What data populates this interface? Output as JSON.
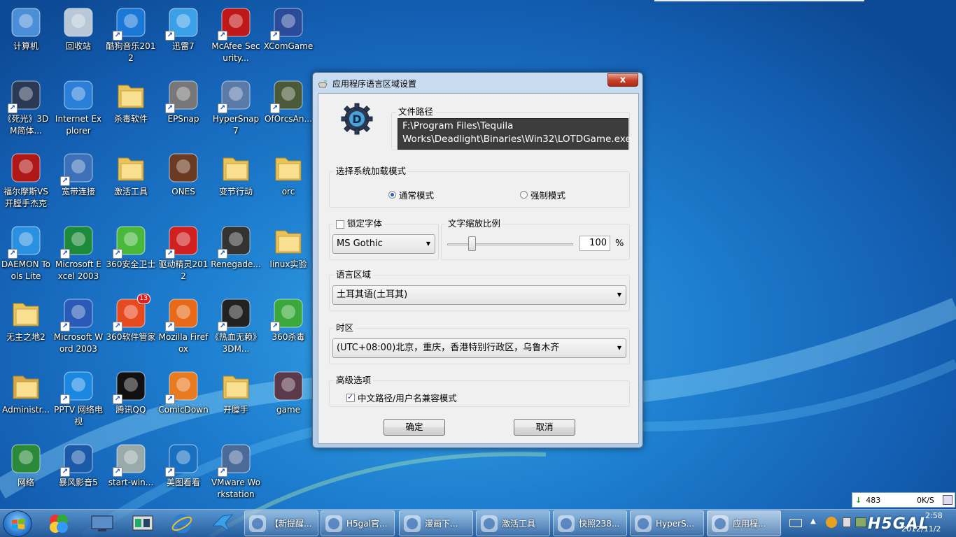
{
  "desktop": {
    "icons": [
      {
        "label": "计算机",
        "icon": "computer-icon",
        "shortcut": false
      },
      {
        "label": "回收站",
        "icon": "recycle-bin-icon",
        "shortcut": false
      },
      {
        "label": "酷狗音乐2012",
        "icon": "kugou-music-icon",
        "shortcut": true
      },
      {
        "label": "迅雷7",
        "icon": "xunlei-bird-icon",
        "shortcut": true
      },
      {
        "label": "McAfee Security...",
        "icon": "mcafee-shield-icon",
        "shortcut": true
      },
      {
        "label": "XComGame",
        "icon": "xcom-icon",
        "shortcut": true
      },
      {
        "label": "《死光》3DM简体...",
        "icon": "deadlight-gear-icon",
        "shortcut": true
      },
      {
        "label": "Internet Explorer",
        "icon": "internet-explorer-icon",
        "shortcut": false
      },
      {
        "label": "杀毒软件",
        "icon": "folder-icon",
        "shortcut": false
      },
      {
        "label": "EPSnap",
        "icon": "camera-icon",
        "shortcut": true
      },
      {
        "label": "HyperSnap 7",
        "icon": "hypersnap-icon",
        "shortcut": true
      },
      {
        "label": "OfOrcsAn...",
        "icon": "orc-helmet-icon",
        "shortcut": true
      },
      {
        "label": "福尔摩斯VS开膛手杰克",
        "icon": "sherlock-icon",
        "shortcut": false
      },
      {
        "label": "宽带连接",
        "icon": "broadband-icon",
        "shortcut": true
      },
      {
        "label": "激活工具",
        "icon": "folder-icon",
        "shortcut": false
      },
      {
        "label": "ONES",
        "icon": "ones-icon",
        "shortcut": false
      },
      {
        "label": "变节行动",
        "icon": "folder-icon",
        "shortcut": false
      },
      {
        "label": "orc",
        "icon": "folder-icon",
        "shortcut": false
      },
      {
        "label": "DAEMON Tools Lite",
        "icon": "daemon-tools-icon",
        "shortcut": true
      },
      {
        "label": "Microsoft Excel 2003",
        "icon": "excel-icon",
        "shortcut": true
      },
      {
        "label": "360安全卫士",
        "icon": "360-safe-icon",
        "shortcut": true
      },
      {
        "label": "驱动精灵2012",
        "icon": "driver-genius-icon",
        "shortcut": true
      },
      {
        "label": "Renegade...",
        "icon": "renegade-icon",
        "shortcut": true
      },
      {
        "label": "linux实验",
        "icon": "folder-icon",
        "shortcut": false
      },
      {
        "label": "无主之地2",
        "icon": "folder-icon",
        "shortcut": false
      },
      {
        "label": "Microsoft Word 2003",
        "icon": "word-icon",
        "shortcut": true
      },
      {
        "label": "360软件管家",
        "icon": "360-software-icon",
        "shortcut": true,
        "badge": "13"
      },
      {
        "label": "Mozilla Firefox",
        "icon": "firefox-icon",
        "shortcut": true
      },
      {
        "label": "《热血无赖》3DM...",
        "icon": "sleeping-dogs-icon",
        "shortcut": true
      },
      {
        "label": "360杀毒",
        "icon": "360-antivirus-icon",
        "shortcut": true
      },
      {
        "label": "Administr...",
        "icon": "user-folder-icon",
        "shortcut": false
      },
      {
        "label": "PPTV 网络电视",
        "icon": "pptv-icon",
        "shortcut": true
      },
      {
        "label": "腾讯QQ",
        "icon": "qq-penguin-icon",
        "shortcut": true
      },
      {
        "label": "ComicDown",
        "icon": "comicdown-icon",
        "shortcut": true
      },
      {
        "label": "开膛手",
        "icon": "folder-icon",
        "shortcut": false
      },
      {
        "label": "game",
        "icon": "game-icon",
        "shortcut": false
      },
      {
        "label": "网络",
        "icon": "network-icon",
        "shortcut": false
      },
      {
        "label": "暴风影音5",
        "icon": "baofeng-icon",
        "shortcut": true
      },
      {
        "label": "start-win...",
        "icon": "start-win-icon",
        "shortcut": true
      },
      {
        "label": "美图看看",
        "icon": "meitu-icon",
        "shortcut": true
      },
      {
        "label": "VMware Workstation",
        "icon": "vmware-icon",
        "shortcut": true
      }
    ]
  },
  "dialog": {
    "title": "应用程序语言区域设置",
    "close_label": "x",
    "file_path_group": "文件路径",
    "file_path": "F:\\Program Files\\Tequila Works\\Deadlight\\Binaries\\Win32\\LOTDGame.exe",
    "load_mode_group": "选择系统加载模式",
    "mode_normal": "通常模式",
    "mode_force": "强制模式",
    "lock_font_label": "锁定字体",
    "font_value": "MS Gothic",
    "scale_group": "文字缩放比例",
    "scale_value": "100",
    "scale_unit": "%",
    "scale_level": 0.18,
    "locale_group": "语言区域",
    "locale_value": "土耳其语(土耳其)",
    "timezone_group": "时区",
    "timezone_value": "(UTC+08:00)北京，重庆，香港特别行政区，乌鲁木齐",
    "advanced_group": "高级选项",
    "compat_label": "中文路径/用户名兼容模式",
    "ok_label": "确定",
    "cancel_label": "取消"
  },
  "taskbar": {
    "buttons": [
      {
        "label": "【新提醒...",
        "icon": "firefox-icon"
      },
      {
        "label": "H5gal官...",
        "icon": "h5gal-icon"
      },
      {
        "label": "漫画下...",
        "icon": "comicdown-icon"
      },
      {
        "label": "激活工具",
        "icon": "folder-icon"
      },
      {
        "label": "快照238...",
        "icon": "meitu-icon"
      },
      {
        "label": "HyperS...",
        "icon": "hypersnap-icon"
      },
      {
        "label": "应用程...",
        "icon": "app-locale-icon"
      }
    ],
    "netmon_down": "483",
    "netmon_up": "0K/S",
    "clock": "2:58",
    "date": "2012/11/2",
    "watermark": "H5GAL"
  }
}
